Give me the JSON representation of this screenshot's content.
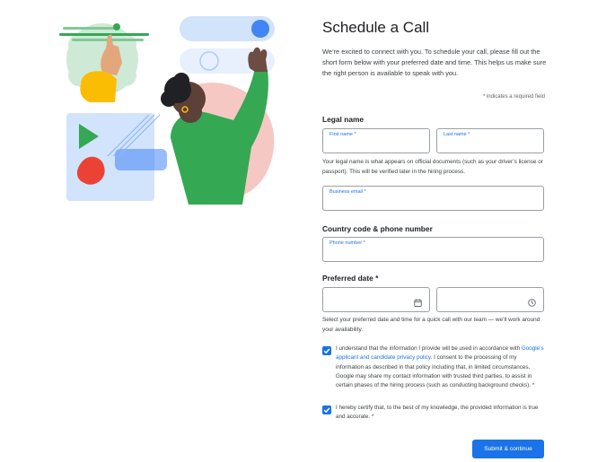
{
  "form": {
    "title": "Schedule a Call",
    "intro": "We’re excited to connect with you. To schedule your call, please fill out the short form below with your preferred date and time. This helps us make sure the right person is available to speak with you.",
    "required_note": "* indicates a required field",
    "legal_name_section": "Legal name",
    "first_name_label": "First name *",
    "last_name_label": "Last name *",
    "legal_name_helper": "Your legal name is what appears on official documents (such as your driver’s license or passport). This will be verified later in the hiring process.",
    "business_email_label": "Business email *",
    "phone_section": "Country code & phone number",
    "phone_label": "Phone number *",
    "date_section": "Preferred date *",
    "date_helper": "Select your preferred date and time for a quick call with our team — we’ll work around your availability.",
    "consent_part1": "I understand that the information I provide will be used in accordance with ",
    "consent_link": "Google’s applicant and candidate privacy policy",
    "consent_part2": ". I consent to the processing of my information as described in that policy including that, in limited circumstances, Google may share my contact information with trusted third parties, to assist in certain phases of the hiring process (such as conducting background checks). *",
    "certify_text": "I hereby certify that, to the best of my knowledge, the provided information is true and accurate. *",
    "submit_label": "Submit & continue",
    "consent_checked": true,
    "certify_checked": true
  },
  "icons": {
    "date": "calendar-icon",
    "time": "clock-icon",
    "checkbox": "checkmark-icon"
  },
  "colors": {
    "accent": "#1a73e8",
    "illustration_green": "#34a853",
    "illustration_blue": "#aecbfa",
    "illustration_pink": "#f6c8c4",
    "illustration_yellow": "#fbbc04",
    "illustration_red": "#ea4335"
  }
}
